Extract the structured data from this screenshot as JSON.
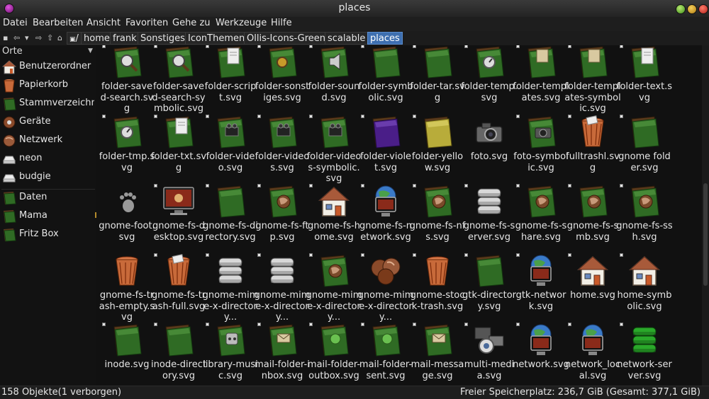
{
  "window": {
    "title": "places"
  },
  "menu": [
    "Datei",
    "Bearbeiten",
    "Ansicht",
    "Favoriten",
    "Gehe zu",
    "Werkzeuge",
    "Hilfe"
  ],
  "breadcrumb": [
    "/",
    "home",
    "frank",
    "Sonstiges",
    "IconThemen",
    "Ollis-Icons-Green",
    "scalable",
    "places"
  ],
  "sidebar": {
    "header": "Orte",
    "items": [
      {
        "label": "Benutzerordner",
        "icon": "home-folder"
      },
      {
        "label": "Papierkorb",
        "icon": "trash"
      },
      {
        "label": "Stammverzeichnis",
        "icon": "folder"
      },
      {
        "label": "Geräte",
        "icon": "devices"
      },
      {
        "label": "Netzwerk",
        "icon": "network"
      },
      {
        "label": "neon",
        "icon": "drive"
      },
      {
        "label": "budgie",
        "icon": "drive"
      },
      {
        "label": "Daten",
        "icon": "folder"
      },
      {
        "label": "Mama",
        "icon": "folder"
      },
      {
        "label": "Fritz Box",
        "icon": "folder"
      }
    ]
  },
  "files": [
    {
      "name": "folder-saved-search.svg",
      "icon": "search-folder"
    },
    {
      "name": "folder-saved-search-symbolic.svg",
      "icon": "search-folder"
    },
    {
      "name": "folder-script.svg",
      "icon": "doc-folder"
    },
    {
      "name": "folder-sonstiges.svg",
      "icon": "misc-folder"
    },
    {
      "name": "folder-sound.svg",
      "icon": "sound-folder"
    },
    {
      "name": "folder-symbolic.svg",
      "icon": "folder"
    },
    {
      "name": "folder-tar.svg",
      "icon": "folder"
    },
    {
      "name": "folder-temp.svg",
      "icon": "temp-folder"
    },
    {
      "name": "folder-templates.svg",
      "icon": "template-folder"
    },
    {
      "name": "folder-templates-symbolic.svg",
      "icon": "template-folder"
    },
    {
      "name": "folder-text.svg",
      "icon": "doc-folder"
    },
    {
      "name": "folder-tmp.svg",
      "icon": "temp-folder"
    },
    {
      "name": "folder-txt.svg",
      "icon": "doc-folder"
    },
    {
      "name": "folder-video.svg",
      "icon": "video-folder"
    },
    {
      "name": "folder-videos.svg",
      "icon": "video-folder"
    },
    {
      "name": "folder-videos-symbolic.svg",
      "icon": "video-folder"
    },
    {
      "name": "folder-violet.svg",
      "icon": "violet-folder"
    },
    {
      "name": "folder-yellow.svg",
      "icon": "yellow-folder"
    },
    {
      "name": "foto.svg",
      "icon": "camera"
    },
    {
      "name": "foto-symbolic.svg",
      "icon": "camera-folder"
    },
    {
      "name": "fulltrashl.svg",
      "icon": "trash-full"
    },
    {
      "name": "gnome folder.svg",
      "icon": "folder"
    },
    {
      "name": "gnome-foot.svg",
      "icon": "foot"
    },
    {
      "name": "gnome-fs-desktop.svg",
      "icon": "desktop"
    },
    {
      "name": "gnome-fs-directory.svg",
      "icon": "folder"
    },
    {
      "name": "gnome-fs-ftp.svg",
      "icon": "globe-folder"
    },
    {
      "name": "gnome-fs-home.svg",
      "icon": "home"
    },
    {
      "name": "gnome-fs-network.svg",
      "icon": "network"
    },
    {
      "name": "gnome-fs-nfs.svg",
      "icon": "globe-folder"
    },
    {
      "name": "gnome-fs-server.svg",
      "icon": "server"
    },
    {
      "name": "gnome-fs-share.svg",
      "icon": "globe-folder"
    },
    {
      "name": "gnome-fs-smb.svg",
      "icon": "globe-folder"
    },
    {
      "name": "gnome-fs-ssh.svg",
      "icon": "globe-folder"
    },
    {
      "name": "gnome-fs-trash-empty.svg",
      "icon": "trash"
    },
    {
      "name": "gnome-fs-trash-full.svg",
      "icon": "trash-full"
    },
    {
      "name": "gnome-mime-x-directory...",
      "icon": "server"
    },
    {
      "name": "gnome-mime-x-directory...",
      "icon": "server"
    },
    {
      "name": "gnome-mime-x-directory...",
      "icon": "globe-folder"
    },
    {
      "name": "gnome-mime-x-directory...",
      "icon": "globes"
    },
    {
      "name": "gnome-stock-trash.svg",
      "icon": "trash"
    },
    {
      "name": "gtk-directory.svg",
      "icon": "folder"
    },
    {
      "name": "gtk-network.svg",
      "icon": "network"
    },
    {
      "name": "home.svg",
      "icon": "home"
    },
    {
      "name": "home-symbolic.svg",
      "icon": "home"
    },
    {
      "name": "inode.svg",
      "icon": "folder"
    },
    {
      "name": "inode-directory.svg",
      "icon": "folder"
    },
    {
      "name": "library-music.svg",
      "icon": "music-folder"
    },
    {
      "name": "mail-folder-inbox.svg",
      "icon": "mail-folder"
    },
    {
      "name": "mail-folder-outbox.svg",
      "icon": "mail-green-folder"
    },
    {
      "name": "mail-folder-sent.svg",
      "icon": "mail-green-folder"
    },
    {
      "name": "mail-message.svg",
      "icon": "mail-folder"
    },
    {
      "name": "multi-media.svg",
      "icon": "multimedia"
    },
    {
      "name": "network.svg",
      "icon": "network"
    },
    {
      "name": "network_local.svg",
      "icon": "network"
    },
    {
      "name": "network-server.svg",
      "icon": "server-green"
    }
  ],
  "status": {
    "left": "158 Objekte(1 verborgen)",
    "right": "Freier Speicherplatz: 236,7 GiB (Gesamt: 377,1 GiB)"
  }
}
